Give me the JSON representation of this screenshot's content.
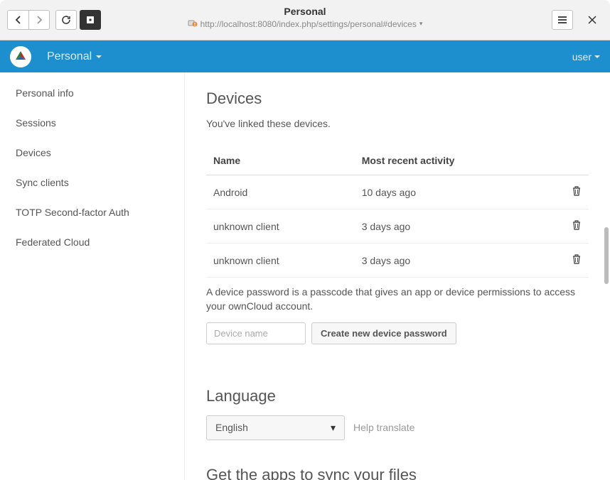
{
  "browser": {
    "title": "Personal",
    "url": "http://localhost:8080/index.php/settings/personal#devices"
  },
  "header": {
    "nav_label": "Personal",
    "user_label": "user"
  },
  "sidebar": {
    "items": [
      {
        "label": "Personal info"
      },
      {
        "label": "Sessions"
      },
      {
        "label": "Devices"
      },
      {
        "label": "Sync clients"
      },
      {
        "label": "TOTP Second-factor Auth"
      },
      {
        "label": "Federated Cloud"
      }
    ]
  },
  "devices": {
    "title": "Devices",
    "subtitle": "You've linked these devices.",
    "columns": {
      "name": "Name",
      "activity": "Most recent activity"
    },
    "rows": [
      {
        "name": "Android",
        "activity": "10 days ago"
      },
      {
        "name": "unknown client",
        "activity": "3 days ago"
      },
      {
        "name": "unknown client",
        "activity": "3 days ago"
      }
    ],
    "note": "A device password is a passcode that gives an app or device permissions to access your ownCloud account.",
    "input_placeholder": "Device name",
    "create_button": "Create new device password"
  },
  "language": {
    "title": "Language",
    "selected": "English",
    "help_link": "Help translate"
  },
  "apps": {
    "title": "Get the apps to sync your files"
  }
}
